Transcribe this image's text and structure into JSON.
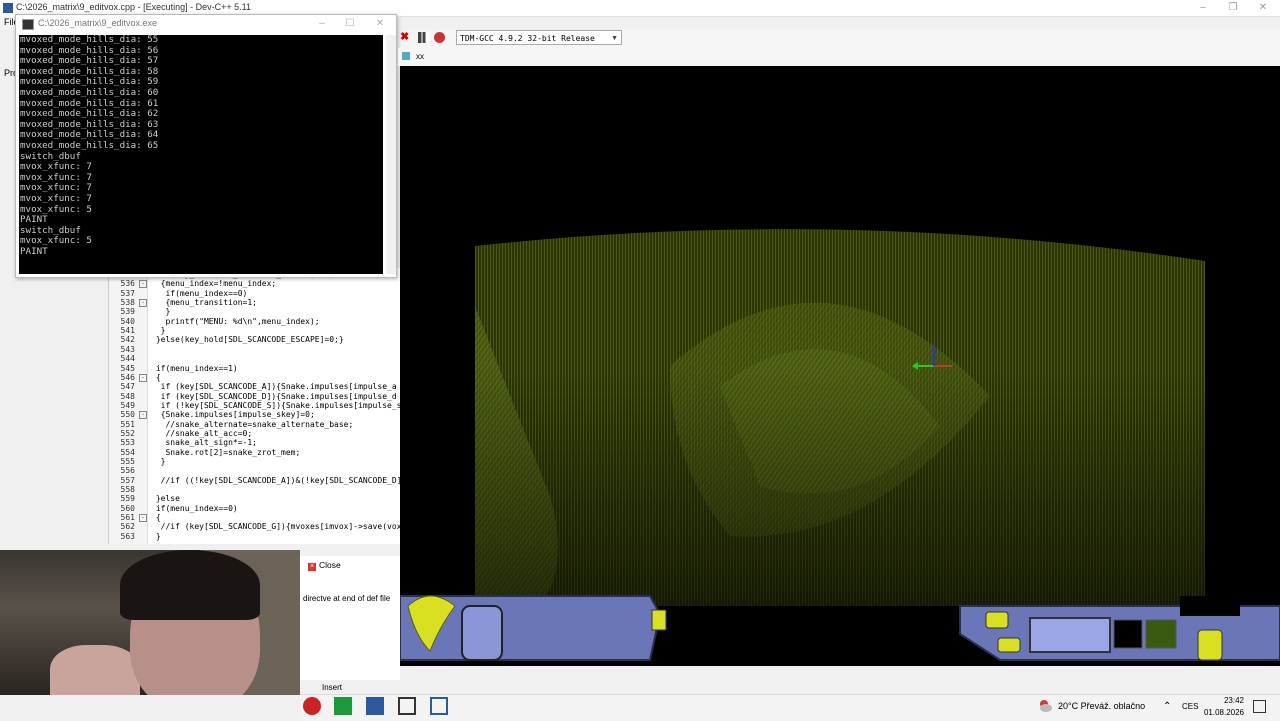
{
  "devcpp": {
    "window_title": "C:\\2026_matrix\\9_editvox.cpp - [Executing] - Dev-C++ 5.11",
    "menu_first": "File",
    "side_label": "Pro",
    "compiler": "TDM-GCC 4.9.2 32-bit Release",
    "tab_title": "xx"
  },
  "console": {
    "title": "C:\\2026_matrix\\9_editvox.exe",
    "lines": [
      "mvoxed_mode_hills_dia: 55",
      "mvoxed_mode_hills_dia: 56",
      "mvoxed_mode_hills_dia: 57",
      "mvoxed_mode_hills_dia: 58",
      "mvoxed_mode_hills_dia: 59",
      "mvoxed_mode_hills_dia: 60",
      "mvoxed_mode_hills_dia: 61",
      "mvoxed_mode_hills_dia: 62",
      "mvoxed_mode_hills_dia: 63",
      "mvoxed_mode_hills_dia: 64",
      "mvoxed_mode_hills_dia: 65",
      "switch_dbuf",
      "mvox_xfunc: 7",
      "mvox_xfunc: 7",
      "mvox_xfunc: 7",
      "mvox_xfunc: 7",
      "mvox_xfunc: 5",
      "PAINT",
      "switch_dbuf",
      "mvox_xfunc: 5",
      "PAINT"
    ]
  },
  "editor": {
    "lines": [
      {
        "n": "535",
        "code": "  if(key_hold[SDL_SCANCODE_ESCAPE]==1)",
        "fold": ""
      },
      {
        "n": "536",
        "code": "  {menu_index=!menu_index;",
        "fold": "-"
      },
      {
        "n": "537",
        "code": "   if(menu_index==0)",
        "fold": ""
      },
      {
        "n": "538",
        "code": "   {menu_transition=1;",
        "fold": "-"
      },
      {
        "n": "539",
        "code": "   }",
        "fold": ""
      },
      {
        "n": "540",
        "code": "   printf(\"MENU: %d\\n\",menu_index);",
        "fold": ""
      },
      {
        "n": "541",
        "code": "  }",
        "fold": ""
      },
      {
        "n": "542",
        "code": " }else(key_hold[SDL_SCANCODE_ESCAPE]=0;}",
        "fold": ""
      },
      {
        "n": "543",
        "code": "",
        "fold": ""
      },
      {
        "n": "544",
        "code": "",
        "fold": ""
      },
      {
        "n": "545",
        "code": " if(menu_index==1)",
        "fold": ""
      },
      {
        "n": "546",
        "code": " {",
        "fold": "-"
      },
      {
        "n": "547",
        "code": "  if (key[SDL_SCANCODE_A]){Snake.impulses[impulse_a",
        "fold": ""
      },
      {
        "n": "548",
        "code": "  if (key[SDL_SCANCODE_D]){Snake.impulses[impulse_d",
        "fold": ""
      },
      {
        "n": "549",
        "code": "  if (!key[SDL_SCANCODE_S]){Snake.impulses[impulse_s",
        "fold": ""
      },
      {
        "n": "550",
        "code": "  {Snake.impulses[impulse_skey]=0;",
        "fold": "-"
      },
      {
        "n": "551",
        "code": "   //snake_alternate=snake_alternate_base;",
        "fold": ""
      },
      {
        "n": "552",
        "code": "   //snake_alt_acc=0;",
        "fold": ""
      },
      {
        "n": "553",
        "code": "   snake_alt_sign*=-1;",
        "fold": ""
      },
      {
        "n": "554",
        "code": "   Snake.rot[2]=snake_zrot_mem;",
        "fold": ""
      },
      {
        "n": "555",
        "code": "  }",
        "fold": ""
      },
      {
        "n": "556",
        "code": "",
        "fold": ""
      },
      {
        "n": "557",
        "code": "  //if ((!key[SDL_SCANCODE_A])&(!key[SDL_SCANCODE_D]",
        "fold": ""
      },
      {
        "n": "558",
        "code": "",
        "fold": ""
      },
      {
        "n": "559",
        "code": " }else",
        "fold": ""
      },
      {
        "n": "560",
        "code": " if(menu_index==0)",
        "fold": ""
      },
      {
        "n": "561",
        "code": " {",
        "fold": "-"
      },
      {
        "n": "562",
        "code": "  //if (key[SDL_SCANCODE_G]){mvoxes[imvox]->save(vox",
        "fold": ""
      },
      {
        "n": "563",
        "code": " }",
        "fold": ""
      }
    ]
  },
  "bottom": {
    "close_label": "Close",
    "message": "directve at end of def file",
    "status_insert": "Insert"
  },
  "taskbar": {
    "weather": "20°C  Převáž. oblačno",
    "lang": "CES",
    "time": "23:42",
    "date": "01.08.2026"
  },
  "colors": {
    "voxel_green": "#4a5a10",
    "hud_blue": "#7a86c8",
    "hud_yellow": "#d8e020"
  }
}
